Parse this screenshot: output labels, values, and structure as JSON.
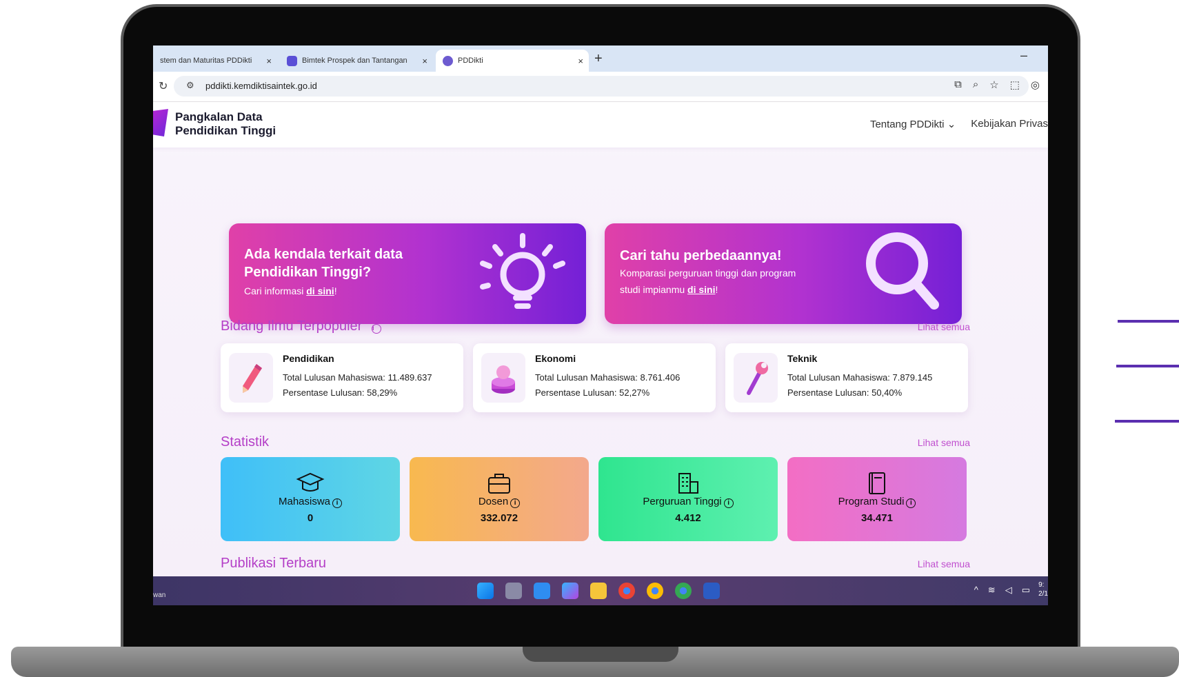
{
  "browser": {
    "tabs": [
      {
        "title": "stem dan Maturitas PDDikti"
      },
      {
        "title": "Bimtek Prospek dan Tantangan"
      },
      {
        "title": "PDDikti"
      }
    ],
    "url": "pddikti.kemdiktisaintek.go.id"
  },
  "header": {
    "logo_line1": "Pangkalan Data",
    "logo_line2": "Pendidikan Tinggi",
    "nav_about": "Tentang PDDikti",
    "nav_privacy": "Kebijakan Privas"
  },
  "banners": [
    {
      "title_line1": "Ada kendala terkait data",
      "title_line2": "Pendidikan Tinggi?",
      "sub_prefix": "Cari informasi ",
      "link": "di sini",
      "sub_suffix": "!",
      "icon": "lightbulb-icon"
    },
    {
      "title_line1": "Cari tahu perbedaannya!",
      "sub_line1": "Komparasi perguruan tinggi dan program",
      "sub_prefix": "studi impianmu ",
      "link": "di sini",
      "sub_suffix": "!",
      "icon": "magnifier-icon"
    }
  ],
  "popular": {
    "title": "Bidang Ilmu Terpopuler",
    "see_all": "Lihat semua",
    "items": [
      {
        "name": "Pendidikan",
        "graduates": "Total Lulusan Mahasiswa: 11.489.637",
        "percent": "Persentase Lulusan: 58,29%",
        "icon": "pencil-icon"
      },
      {
        "name": "Ekonomi",
        "graduates": "Total Lulusan Mahasiswa: 8.761.406",
        "percent": "Persentase Lulusan: 52,27%",
        "icon": "coins-icon"
      },
      {
        "name": "Teknik",
        "graduates": "Total Lulusan Mahasiswa: 7.879.145",
        "percent": "Persentase Lulusan: 50,40%",
        "icon": "wrench-icon"
      }
    ]
  },
  "stats": {
    "title": "Statistik",
    "see_all": "Lihat semua",
    "items": [
      {
        "label": "Mahasiswa",
        "value": "0",
        "icon": "graduation-cap-icon"
      },
      {
        "label": "Dosen",
        "value": "332.072",
        "icon": "briefcase-icon"
      },
      {
        "label": "Perguruan Tinggi",
        "value": "4.412",
        "icon": "building-icon"
      },
      {
        "label": "Program Studi",
        "value": "34.471",
        "icon": "book-icon"
      }
    ]
  },
  "publications": {
    "title": "Publikasi Terbaru",
    "see_all": "Lihat semua"
  },
  "taskbar": {
    "left_text": "wan",
    "clock_line1": "9:",
    "clock_line2": "2/1"
  },
  "colors": {
    "accent": "#b43ec7",
    "stat_mahasiswa": "#4cc3f5",
    "stat_dosen": "#f5b266",
    "stat_pt": "#45e79b",
    "stat_prodi": "#e56fc9"
  }
}
